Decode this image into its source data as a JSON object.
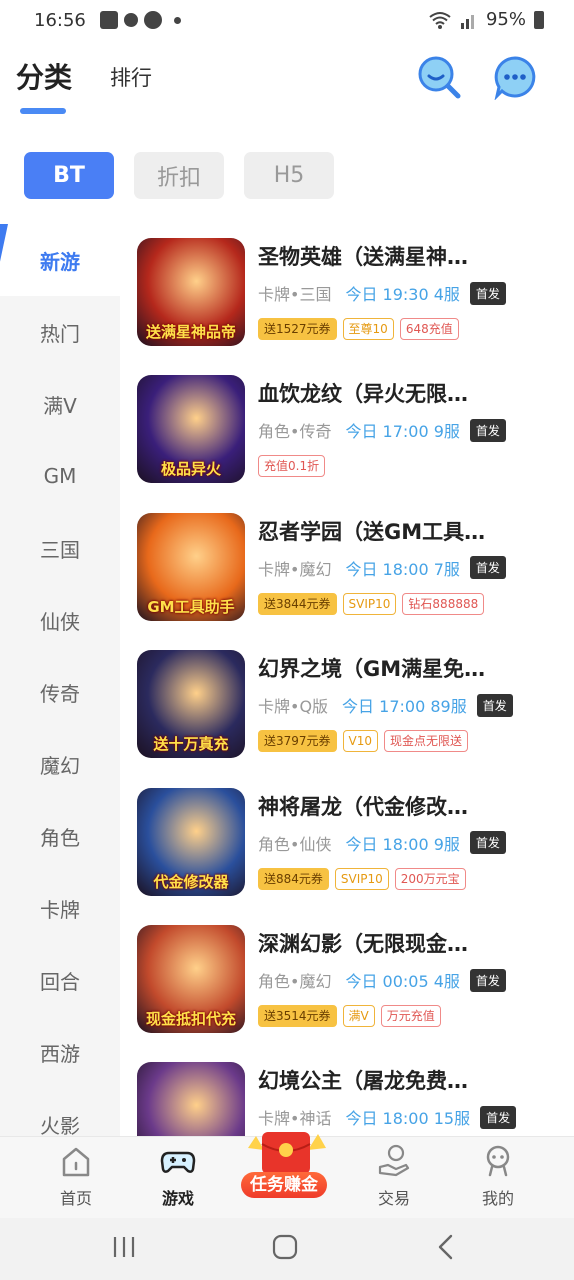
{
  "status_bar": {
    "time": "16:56",
    "battery": "95%"
  },
  "header": {
    "tab_active": "分类",
    "tab_other": "排行"
  },
  "platform_chips": [
    {
      "label": "BT",
      "active": true
    },
    {
      "label": "折扣",
      "active": false
    },
    {
      "label": "H5",
      "active": false
    }
  ],
  "sidebar": {
    "items": [
      "新游",
      "热门",
      "满V",
      "GM",
      "三国",
      "仙侠",
      "传奇",
      "魔幻",
      "角色",
      "卡牌",
      "回合",
      "西游",
      "火影"
    ],
    "active_index": 0
  },
  "games": [
    {
      "name": "圣物英雄（送满星神…",
      "genre": "卡牌•三国",
      "server": "今日 19:30 4服",
      "badge": "首发",
      "icon_text": "送满星神品帝",
      "icon_color": "#b5281c",
      "tags": [
        {
          "text": "送1527元券",
          "kind": "coupon"
        },
        {
          "text": "至尊10",
          "kind": "vip"
        },
        {
          "text": "648充值",
          "kind": "recharge"
        }
      ]
    },
    {
      "name": "血饮龙纹（异火无限…",
      "genre": "角色•传奇",
      "server": "今日 17:00 9服",
      "badge": "首发",
      "icon_text": "极品异火",
      "icon_color": "#3a1f7a",
      "tags": [
        {
          "text": "充值0.1折",
          "kind": "recharge"
        }
      ]
    },
    {
      "name": "忍者学园（送GM工具…",
      "genre": "卡牌•魔幻",
      "server": "今日 18:00 7服",
      "badge": "首发",
      "icon_text": "GM工具助手",
      "icon_color": "#e8691b",
      "tags": [
        {
          "text": "送3844元券",
          "kind": "coupon"
        },
        {
          "text": "SVIP10",
          "kind": "vip"
        },
        {
          "text": "钻石888888",
          "kind": "recharge"
        }
      ]
    },
    {
      "name": "幻界之境（GM满星免…",
      "genre": "卡牌•Q版",
      "server": "今日 17:00 89服",
      "badge": "首发",
      "icon_text": "送十万真充",
      "icon_color": "#2b2a5e",
      "tags": [
        {
          "text": "送3797元券",
          "kind": "coupon"
        },
        {
          "text": "V10",
          "kind": "vip"
        },
        {
          "text": "现金点无限送",
          "kind": "recharge"
        }
      ]
    },
    {
      "name": "神将屠龙（代金修改…",
      "genre": "角色•仙侠",
      "server": "今日 18:00 9服",
      "badge": "首发",
      "icon_text": "代金修改器",
      "icon_color": "#2a4f9c",
      "tags": [
        {
          "text": "送884元券",
          "kind": "coupon"
        },
        {
          "text": "SVIP10",
          "kind": "vip"
        },
        {
          "text": "200万元宝",
          "kind": "recharge"
        }
      ]
    },
    {
      "name": "深渊幻影（无限现金…",
      "genre": "角色•魔幻",
      "server": "今日 00:05 4服",
      "badge": "首发",
      "icon_text": "现金抵扣代充",
      "icon_color": "#c24a2c",
      "tags": [
        {
          "text": "送3514元券",
          "kind": "coupon"
        },
        {
          "text": "满V",
          "kind": "vip"
        },
        {
          "text": "万元充值",
          "kind": "recharge"
        }
      ]
    },
    {
      "name": "幻境公主（屠龙免费…",
      "genre": "卡牌•神话",
      "server": "今日 18:00 15服",
      "badge": "首发",
      "icon_text": "",
      "icon_color": "#6b3a8a",
      "tags": []
    }
  ],
  "bottom_nav": [
    {
      "label": "首页",
      "icon": "home-icon",
      "active": false
    },
    {
      "label": "游戏",
      "icon": "gamepad-icon",
      "active": true
    },
    {
      "label": "交易",
      "icon": "trade-icon",
      "active": false
    },
    {
      "label": "我的",
      "icon": "profile-icon",
      "active": false
    }
  ],
  "task_button": {
    "label": "任务赚金"
  },
  "colors": {
    "accent": "#4a7ff5",
    "server_text": "#46a3e6",
    "coupon_bg": "#f7c242"
  }
}
